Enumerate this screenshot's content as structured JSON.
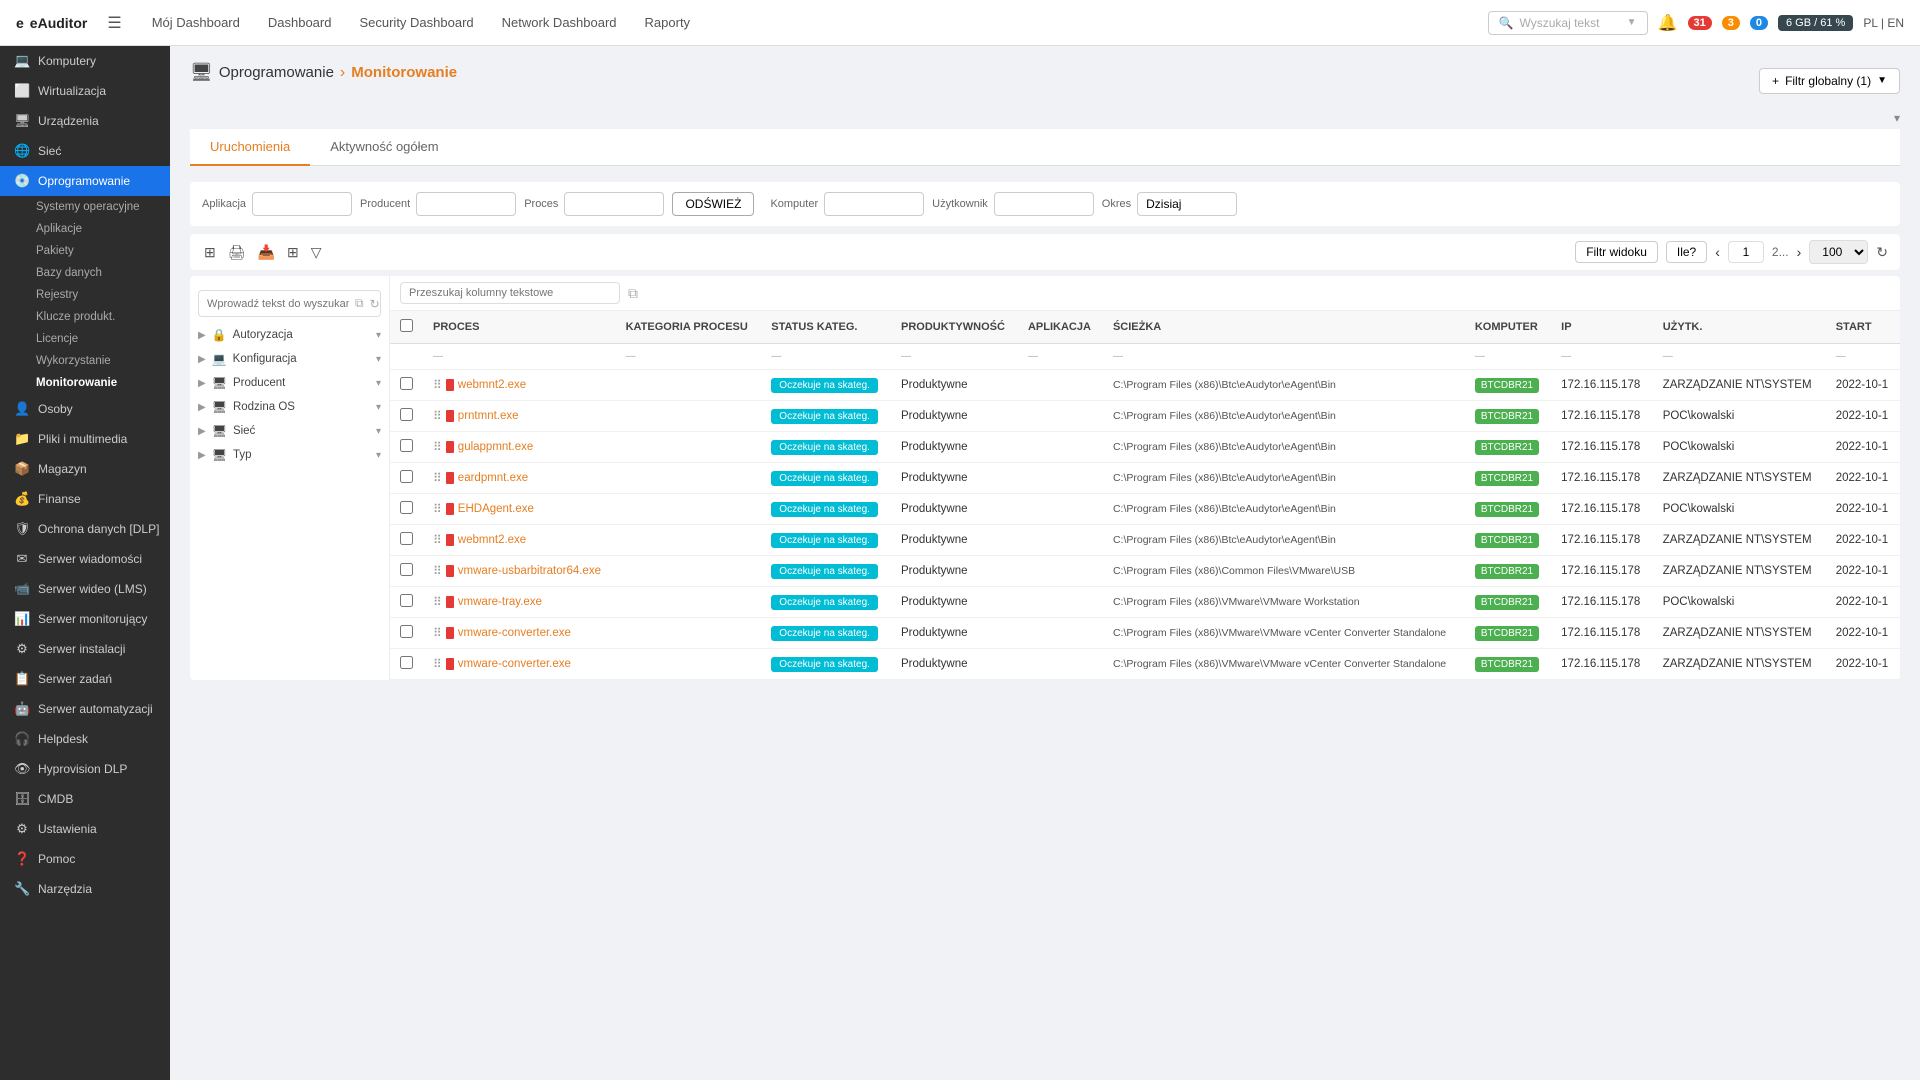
{
  "app": {
    "logo": "eAuditor",
    "menu_icon": "☰"
  },
  "topnav": {
    "links": [
      {
        "label": "Mój Dashboard",
        "id": "my-dashboard"
      },
      {
        "label": "Dashboard",
        "id": "dashboard"
      },
      {
        "label": "Security Dashboard",
        "id": "security-dashboard"
      },
      {
        "label": "Network Dashboard",
        "id": "network-dashboard"
      },
      {
        "label": "Raporty",
        "id": "raporty"
      }
    ],
    "search_placeholder": "Wyszukaj tekst",
    "badges": {
      "red": "31",
      "orange": "3",
      "blue": "0"
    },
    "memory": "6 GB / 61 %",
    "lang": "PL | EN",
    "bell_icon": "🔔"
  },
  "sidebar": {
    "items": [
      {
        "label": "Komputery",
        "icon": "💻",
        "id": "komputery"
      },
      {
        "label": "Wirtualizacja",
        "icon": "⬜",
        "id": "wirtualizacja"
      },
      {
        "label": "Urządzenia",
        "icon": "🖥",
        "id": "urzadzenia"
      },
      {
        "label": "Sieć",
        "icon": "🌐",
        "id": "siec"
      },
      {
        "label": "Oprogramowanie",
        "icon": "💿",
        "id": "oprogramowanie",
        "active": true
      },
      {
        "label": "Osoby",
        "icon": "👤",
        "id": "osoby"
      },
      {
        "label": "Pliki i multimedia",
        "icon": "📁",
        "id": "pliki"
      },
      {
        "label": "Magazyn",
        "icon": "📦",
        "id": "magazyn"
      },
      {
        "label": "Finanse",
        "icon": "💰",
        "id": "finanse"
      },
      {
        "label": "Ochrona danych [DLP]",
        "icon": "🛡",
        "id": "dlp"
      },
      {
        "label": "Serwer wiadomości",
        "icon": "✉",
        "id": "serwer-wiadomosci"
      },
      {
        "label": "Serwer wideo (LMS)",
        "icon": "📹",
        "id": "serwer-wideo"
      },
      {
        "label": "Serwer monitorujący",
        "icon": "📊",
        "id": "serwer-monitorujacy"
      },
      {
        "label": "Serwer instalacji",
        "icon": "⚙",
        "id": "serwer-instalacji"
      },
      {
        "label": "Serwer zadań",
        "icon": "📋",
        "id": "serwer-zadan"
      },
      {
        "label": "Serwer automatyzacji",
        "icon": "🤖",
        "id": "serwer-automatyzacji"
      },
      {
        "label": "Helpdesk",
        "icon": "🎧",
        "id": "helpdesk"
      },
      {
        "label": "Hyprovision DLP",
        "icon": "👁",
        "id": "hyprovision"
      },
      {
        "label": "CMDB",
        "icon": "🗄",
        "id": "cmdb"
      },
      {
        "label": "Ustawienia",
        "icon": "⚙",
        "id": "ustawienia"
      },
      {
        "label": "Pomoc",
        "icon": "❓",
        "id": "pomoc"
      },
      {
        "label": "Narzędzia",
        "icon": "🔧",
        "id": "narzedzia"
      }
    ],
    "sub_items_oprogramowanie": [
      {
        "label": "Systemy operacyjne",
        "id": "systemy"
      },
      {
        "label": "Aplikacje",
        "id": "aplikacje"
      },
      {
        "label": "Pakiety",
        "id": "pakiety"
      },
      {
        "label": "Bazy danych",
        "id": "bazy-danych"
      },
      {
        "label": "Rejestry",
        "id": "rejestry"
      },
      {
        "label": "Klucze produkt.",
        "id": "klucze"
      },
      {
        "label": "Licencje",
        "id": "licencje"
      },
      {
        "label": "Wykorzystanie",
        "id": "wykorzystanie"
      },
      {
        "label": "Monitorowanie",
        "id": "monitorowanie",
        "active": true
      }
    ]
  },
  "breadcrumb": {
    "icon": "🖥",
    "parent": "Oprogramowanie",
    "separator": "›",
    "current": "Monitorowanie"
  },
  "filter_global": {
    "label": "Filtr globalny (1)",
    "plus": "+"
  },
  "tabs": [
    {
      "label": "Uruchomienia",
      "id": "uruchomienia",
      "active": true
    },
    {
      "label": "Aktywność ogółem",
      "id": "aktywnosc"
    }
  ],
  "filters": {
    "aplikacja_label": "Aplikacja",
    "producent_label": "Producent",
    "proces_label": "Proces",
    "refresh_label": "ODŚWIEŻ",
    "komputer_label": "Komputer",
    "uzytkownik_label": "Użytkownik",
    "okres_label": "Okres",
    "dzisiaj_value": "Dzisiaj"
  },
  "tree": {
    "search_placeholder": "Wprowadź tekst do wyszukania",
    "items": [
      {
        "label": "Autoryzacja",
        "icon": "🔒",
        "has_children": true
      },
      {
        "label": "Konfiguracja",
        "icon": "💻",
        "has_children": true
      },
      {
        "label": "Producent",
        "icon": "🖥",
        "has_children": true
      },
      {
        "label": "Rodzina OS",
        "icon": "🖥",
        "has_children": true
      },
      {
        "label": "Sieć",
        "icon": "🖥",
        "has_children": true
      },
      {
        "label": "Typ",
        "icon": "🖥",
        "has_children": true
      }
    ]
  },
  "table": {
    "search_placeholder": "Przeszukaj kolumny tekstowe",
    "columns": [
      "PROCES",
      "KATEGORIA PROCESU",
      "STATUS KATEG.",
      "PRODUKTYWNOŚĆ",
      "APLIKACJA",
      "ŚCIEŻKA",
      "KOMPUTER",
      "IP",
      "UŻYTK.",
      "START"
    ],
    "rows": [
      {
        "process": "webmnt2.exe",
        "category": "",
        "status": "Oczekuje na skateg.",
        "productivity": "Produktywne",
        "application": "",
        "path": "C:\\Program Files (x86)\\Btc\\eAudytor\\eAgent\\Bin",
        "computer": "BTCDBR21",
        "ip": "172.16.115.178",
        "user": "ZARZĄDZANIE NT\\SYSTEM",
        "start": "2022-10-1"
      },
      {
        "process": "prntmnt.exe",
        "category": "",
        "status": "Oczekuje na skateg.",
        "productivity": "Produktywne",
        "application": "",
        "path": "C:\\Program Files (x86)\\Btc\\eAudytor\\eAgent\\Bin",
        "computer": "BTCDBR21",
        "ip": "172.16.115.178",
        "user": "POC\\kowalski",
        "start": "2022-10-1"
      },
      {
        "process": "gulappmnt.exe",
        "category": "",
        "status": "Oczekuje na skateg.",
        "productivity": "Produktywne",
        "application": "",
        "path": "C:\\Program Files (x86)\\Btc\\eAudytor\\eAgent\\Bin",
        "computer": "BTCDBR21",
        "ip": "172.16.115.178",
        "user": "POC\\kowalski",
        "start": "2022-10-1"
      },
      {
        "process": "eardpmnt.exe",
        "category": "",
        "status": "Oczekuje na skateg.",
        "productivity": "Produktywne",
        "application": "",
        "path": "C:\\Program Files (x86)\\Btc\\eAudytor\\eAgent\\Bin",
        "computer": "BTCDBR21",
        "ip": "172.16.115.178",
        "user": "ZARZĄDZANIE NT\\SYSTEM",
        "start": "2022-10-1"
      },
      {
        "process": "EHDAgent.exe",
        "category": "",
        "status": "Oczekuje na skateg.",
        "productivity": "Produktywne",
        "application": "",
        "path": "C:\\Program Files (x86)\\Btc\\eAudytor\\eAgent\\Bin",
        "computer": "BTCDBR21",
        "ip": "172.16.115.178",
        "user": "POC\\kowalski",
        "start": "2022-10-1"
      },
      {
        "process": "webmnt2.exe",
        "category": "",
        "status": "Oczekuje na skateg.",
        "productivity": "Produktywne",
        "application": "",
        "path": "C:\\Program Files (x86)\\Btc\\eAudytor\\eAgent\\Bin",
        "computer": "BTCDBR21",
        "ip": "172.16.115.178",
        "user": "ZARZĄDZANIE NT\\SYSTEM",
        "start": "2022-10-1"
      },
      {
        "process": "vmware-usbarbitrator64.exe",
        "category": "",
        "status": "Oczekuje na skateg.",
        "productivity": "Produktywne",
        "application": "",
        "path": "C:\\Program Files (x86)\\Common Files\\VMware\\USB",
        "computer": "BTCDBR21",
        "ip": "172.16.115.178",
        "user": "ZARZĄDZANIE NT\\SYSTEM",
        "start": "2022-10-1"
      },
      {
        "process": "vmware-tray.exe",
        "category": "",
        "status": "Oczekuje na skateg.",
        "productivity": "Produktywne",
        "application": "",
        "path": "C:\\Program Files (x86)\\VMware\\VMware Workstation",
        "computer": "BTCDBR21",
        "ip": "172.16.115.178",
        "user": "POC\\kowalski",
        "start": "2022-10-1"
      },
      {
        "process": "vmware-converter.exe",
        "category": "",
        "status": "Oczekuje na skateg.",
        "productivity": "Produktywne",
        "application": "",
        "path": "C:\\Program Files (x86)\\VMware\\VMware vCenter Converter Standalone",
        "computer": "BTCDBR21",
        "ip": "172.16.115.178",
        "user": "ZARZĄDZANIE NT\\SYSTEM",
        "start": "2022-10-1"
      },
      {
        "process": "vmware-converter.exe",
        "category": "",
        "status": "Oczekuje na skateg.",
        "productivity": "Produktywne",
        "application": "",
        "path": "C:\\Program Files (x86)\\VMware\\VMware vCenter Converter Standalone",
        "computer": "BTCDBR21",
        "ip": "172.16.115.178",
        "user": "ZARZĄDZANIE NT\\SYSTEM",
        "start": "2022-10-1"
      }
    ]
  },
  "pagination": {
    "filter_view_label": "Filtr widoku",
    "ile_label": "Ile?",
    "page_current": "1",
    "page_next_label": "2...",
    "per_page": "100"
  }
}
